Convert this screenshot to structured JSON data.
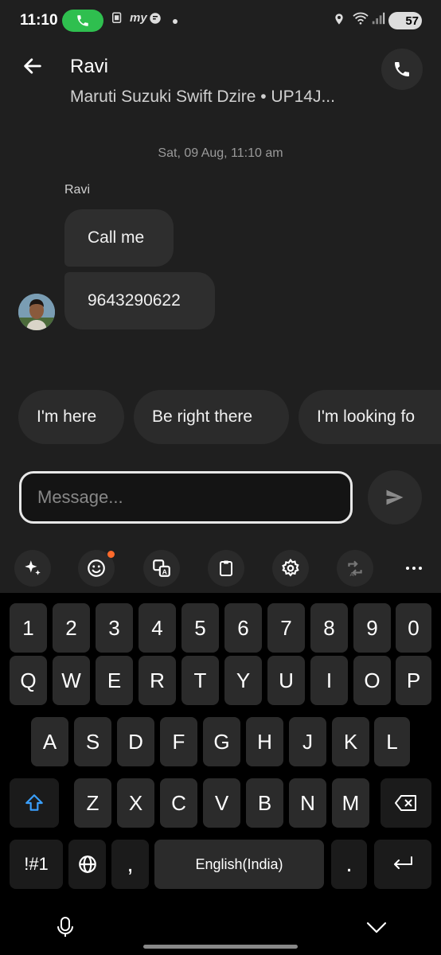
{
  "status_bar": {
    "time": "11:10",
    "battery": "57",
    "icons": [
      "call-active-icon",
      "copy-icon",
      "myntra-icon",
      "chat-icon",
      "dot-icon",
      "location-icon",
      "wifi-icon",
      "signal-icon",
      "battery-icon"
    ]
  },
  "header": {
    "title": "Ravi",
    "subtitle": "Maruti Suzuki Swift Dzire • UP14J..."
  },
  "chat": {
    "date": "Sat, 09 Aug, 11:10 am",
    "sender": "Ravi",
    "messages": [
      "Call me",
      "9643290622"
    ]
  },
  "quick_replies": [
    "I'm here",
    "Be right there",
    "I'm looking fo"
  ],
  "composer": {
    "placeholder": "Message..."
  },
  "keyboard": {
    "toolbar": [
      "sparkle-icon",
      "emoji-icon",
      "translate-icon",
      "clipboard-icon",
      "settings-icon",
      "text-swap-icon",
      "more-icon"
    ],
    "row_numbers": [
      "1",
      "2",
      "3",
      "4",
      "5",
      "6",
      "7",
      "8",
      "9",
      "0"
    ],
    "row_q": [
      "Q",
      "W",
      "E",
      "R",
      "T",
      "Y",
      "U",
      "I",
      "O",
      "P"
    ],
    "row_a": [
      "A",
      "S",
      "D",
      "F",
      "G",
      "H",
      "J",
      "K",
      "L"
    ],
    "row_z": [
      "Z",
      "X",
      "C",
      "V",
      "B",
      "N",
      "M"
    ],
    "symbols_label": "!#1",
    "comma": ",",
    "space_label": "English(India)",
    "period": "."
  },
  "colors": {
    "accent": "#3aa0ff",
    "call_pill": "#2fbf4f",
    "notification_dot": "#ff6a2b"
  }
}
